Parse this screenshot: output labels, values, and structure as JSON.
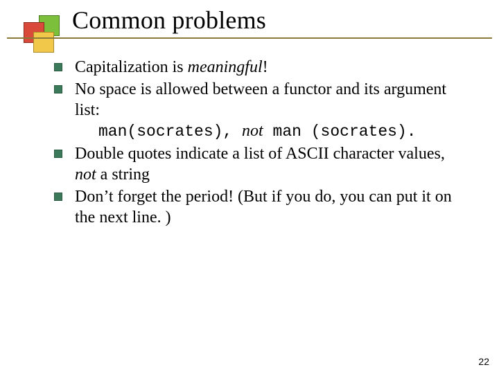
{
  "title": "Common problems",
  "bullets": {
    "b0": {
      "plain": "Capitalization is ",
      "em": "meaningful",
      "tail": "!"
    },
    "b1": {
      "line1": "No space is allowed between a functor and its argument list:",
      "code_good": "man(socrates)",
      "sep": ", ",
      "not_label": "not",
      "code_bad": " man (socrates)."
    },
    "b2": {
      "pre": "Double quotes indicate a list of ASCII character values, ",
      "em": "not",
      "post": " a string"
    },
    "b3": {
      "text": "Don’t forget the period! (But if you do, you can put it on the next line. )"
    }
  },
  "page_number": "22"
}
